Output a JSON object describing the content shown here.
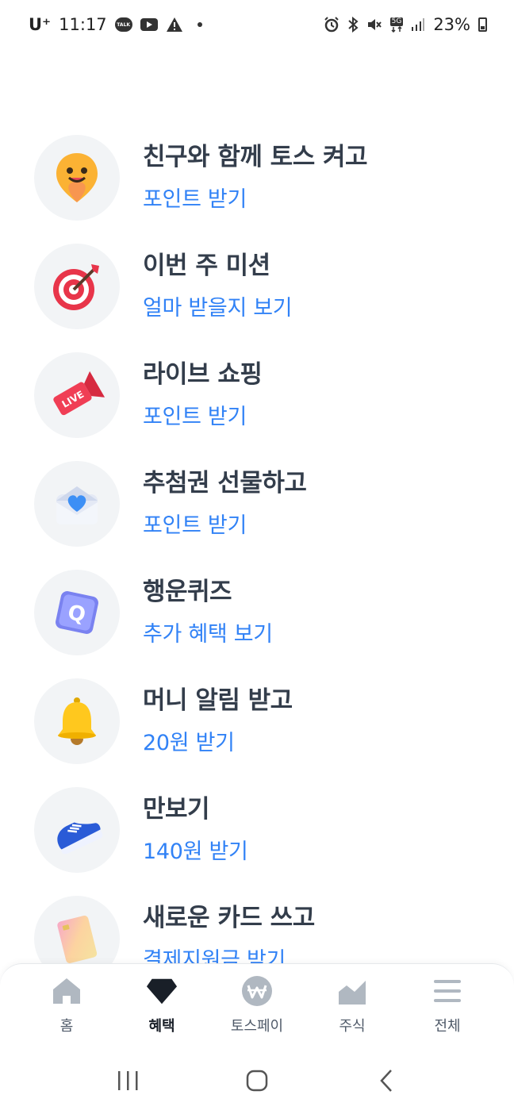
{
  "status": {
    "carrier": "U⁺",
    "time": "11:17",
    "battery": "23%",
    "network": "5G"
  },
  "items": [
    {
      "title": "친구와 함께 토스 켜고",
      "subtitle": "포인트 받기",
      "icon": "smiley-pin-icon"
    },
    {
      "title": "이번 주 미션",
      "subtitle": "얼마 받을지 보기",
      "icon": "target-dart-icon"
    },
    {
      "title": "라이브 쇼핑",
      "subtitle": "포인트 받기",
      "icon": "live-megaphone-icon"
    },
    {
      "title": "추첨권 선물하고",
      "subtitle": "포인트 받기",
      "icon": "heart-envelope-icon"
    },
    {
      "title": "행운퀴즈",
      "subtitle": "추가 혜택 보기",
      "icon": "quiz-block-icon"
    },
    {
      "title": "머니 알림 받고",
      "subtitle": "20원 받기",
      "icon": "bell-icon"
    },
    {
      "title": "만보기",
      "subtitle": "140원 받기",
      "icon": "sneaker-icon"
    },
    {
      "title": "새로운 카드 쓰고",
      "subtitle": "결제지원금 받기",
      "icon": "credit-card-icon"
    }
  ],
  "tabs": [
    {
      "label": "홈",
      "icon": "home-icon"
    },
    {
      "label": "혜택",
      "icon": "gem-icon",
      "active": true
    },
    {
      "label": "토스페이",
      "icon": "won-coin-icon"
    },
    {
      "label": "주식",
      "icon": "stock-chart-icon"
    },
    {
      "label": "전체",
      "icon": "menu-icon"
    }
  ],
  "colors": {
    "accent": "#3182f6",
    "title": "#333d4b",
    "icon_bg": "#f2f4f6",
    "tab_inactive": "#b0b8c1",
    "tab_active": "#191f28"
  }
}
